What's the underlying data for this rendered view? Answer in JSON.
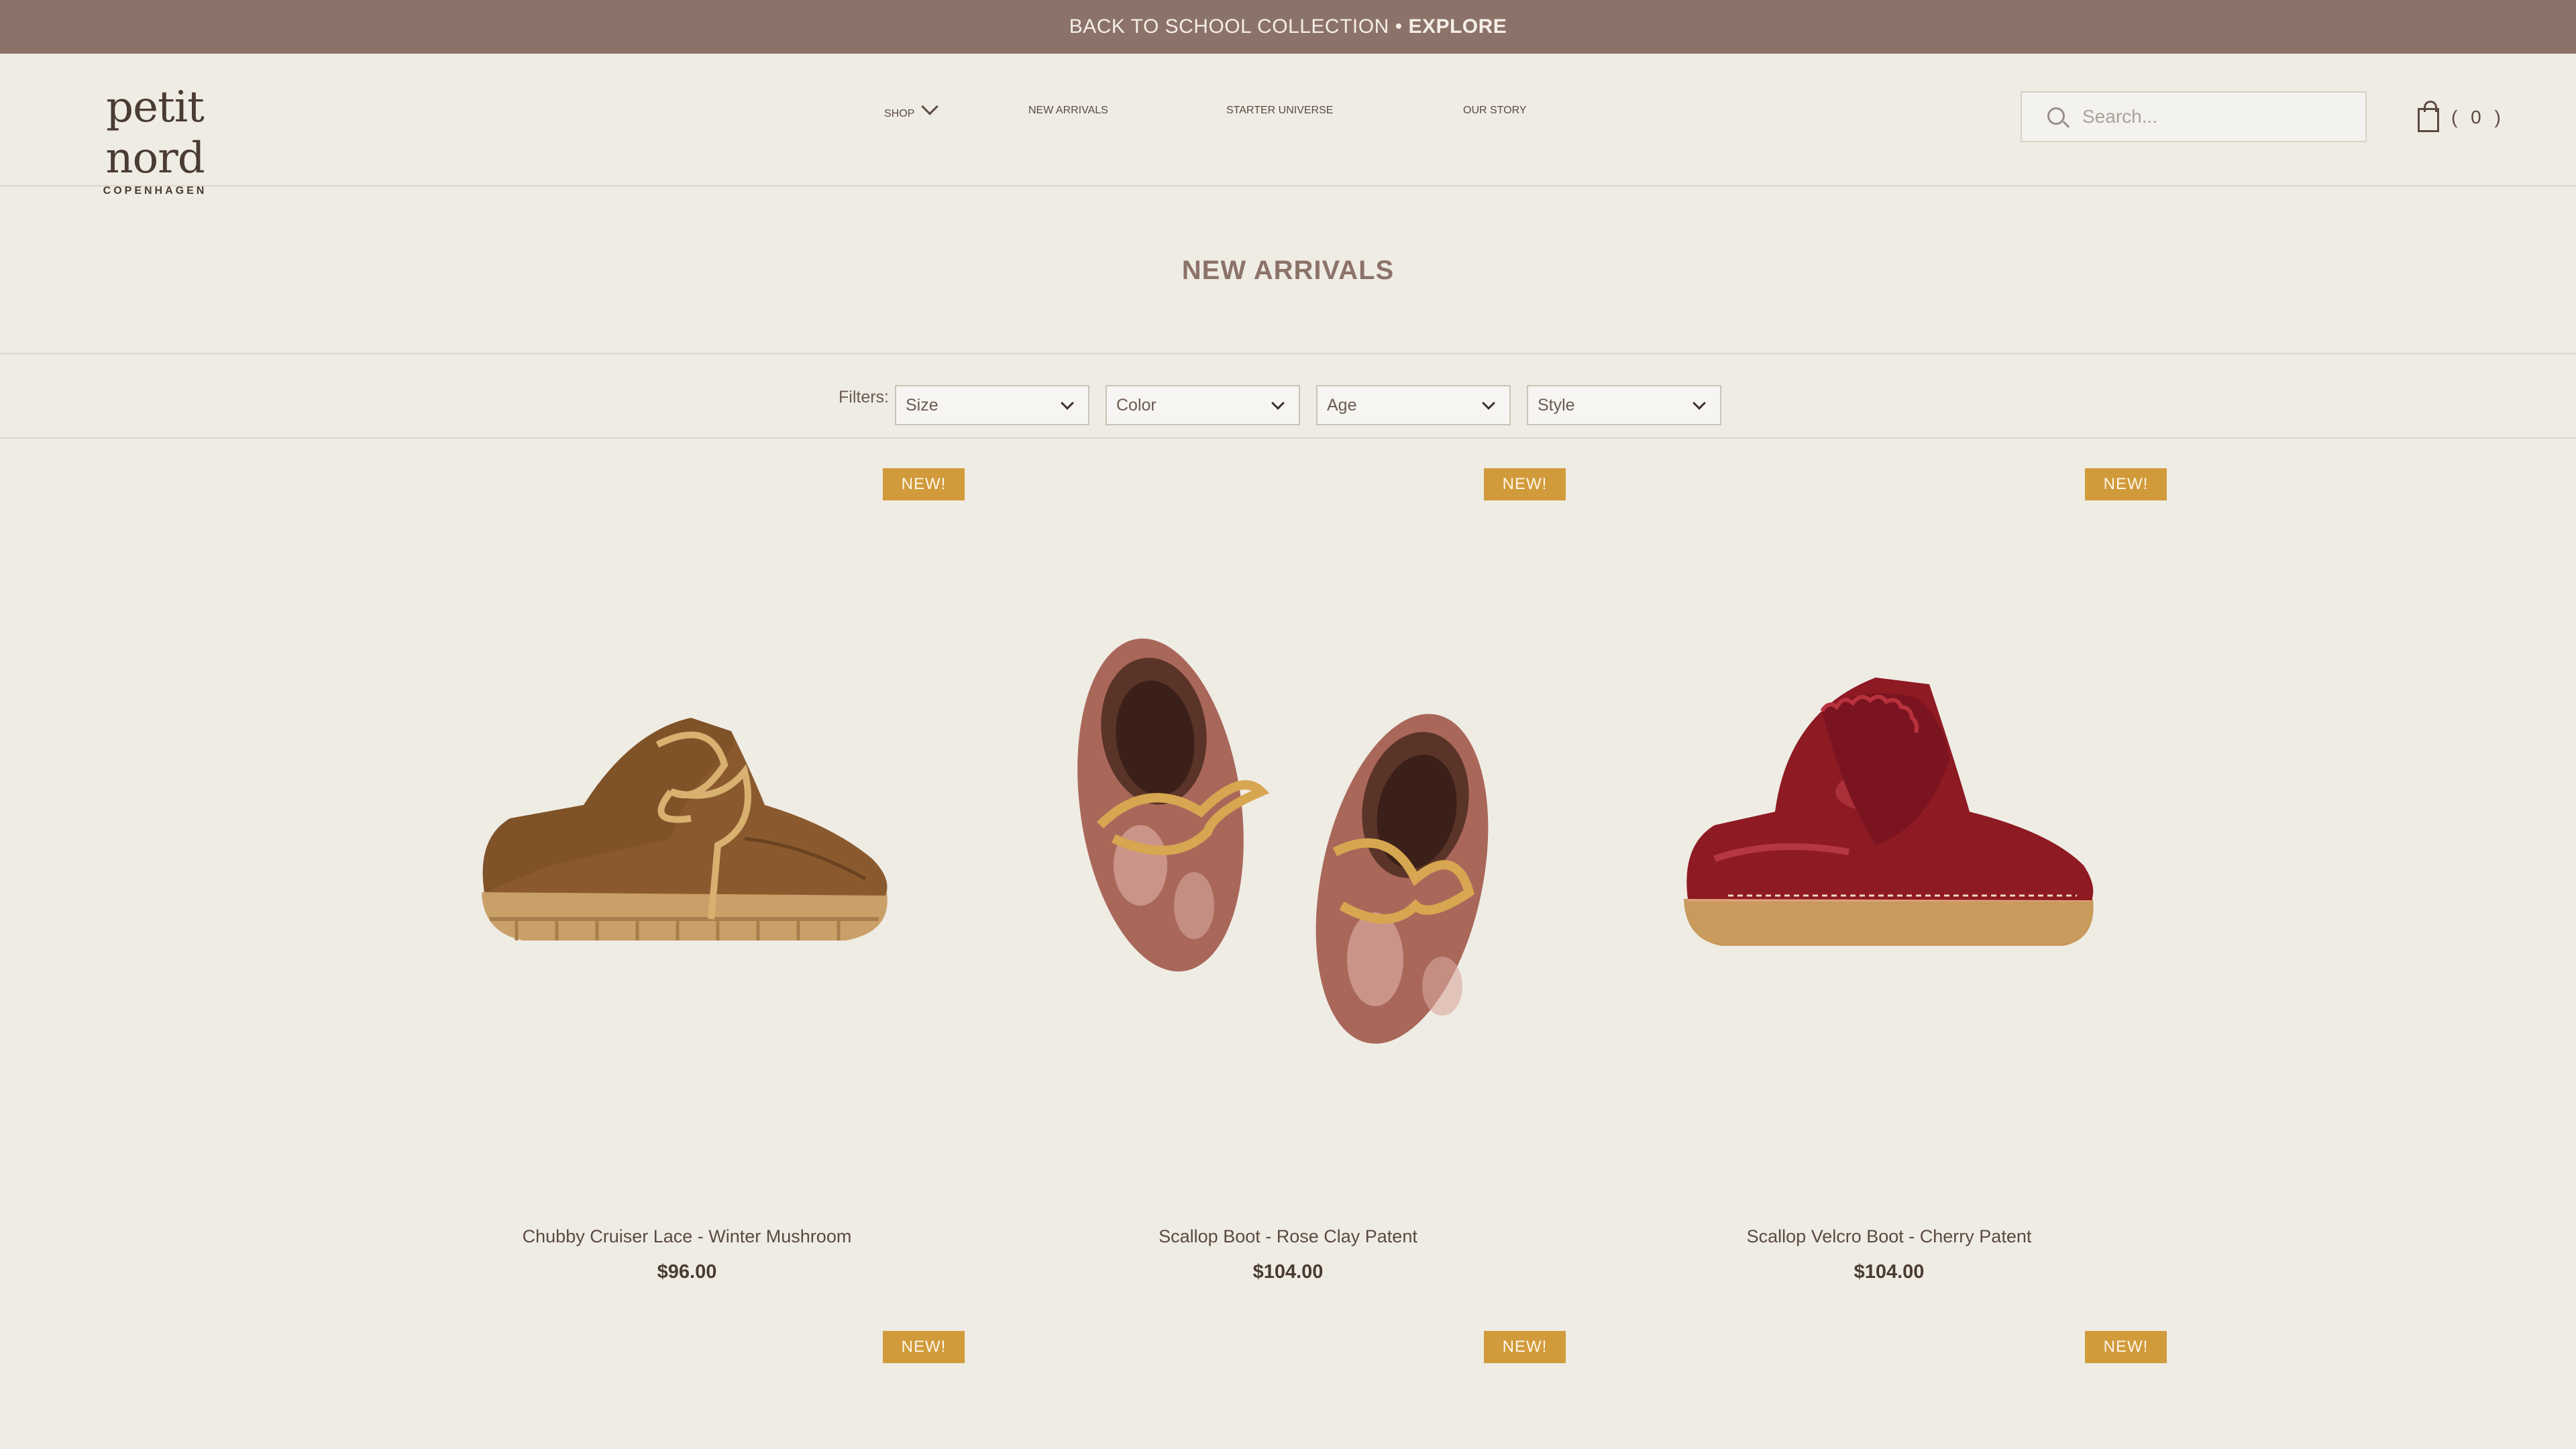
{
  "announcement": {
    "text": "BACK TO SCHOOL COLLECTION • ",
    "link": "EXPLORE"
  },
  "logo": {
    "name": "petit nord",
    "sub": "COPENHAGEN"
  },
  "nav": {
    "shop": "SHOP",
    "new_arrivals": "NEW ARRIVALS",
    "starter_universe": "STARTER UNIVERSE",
    "our_story": "OUR STORY"
  },
  "search": {
    "placeholder": "Search..."
  },
  "cart": {
    "count_text": "( 0 )"
  },
  "page_title": "NEW ARRIVALS",
  "filters": {
    "label": "Filters:",
    "size": "Size",
    "color": "Color",
    "age": "Age",
    "style": "Style"
  },
  "badge_text": "NEW!",
  "products": [
    {
      "name": "Chubby Cruiser Lace - Winter Mushroom",
      "price": "$96.00"
    },
    {
      "name": "Scallop Boot - Rose Clay Patent",
      "price": "$104.00"
    },
    {
      "name": "Scallop Velcro Boot - Cherry Patent",
      "price": "$104.00"
    }
  ],
  "colors": {
    "announcement_bar": "#8c7369",
    "background": "#efece4",
    "badge": "#d19b3b",
    "title": "#8c7369"
  }
}
